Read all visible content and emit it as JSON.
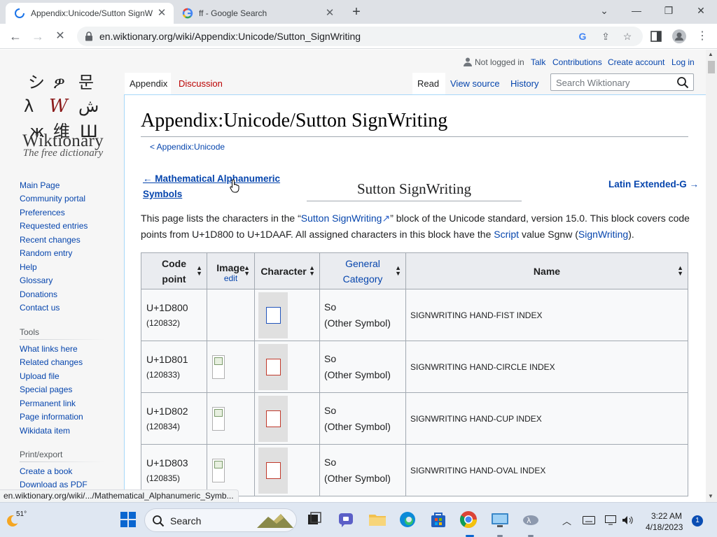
{
  "browser": {
    "tabs": [
      {
        "title": "Appendix:Unicode/Sutton SignW",
        "active": true
      },
      {
        "title": "ff - Google Search",
        "active": false
      }
    ],
    "url": "en.wiktionary.org/wiki/Appendix:Unicode/Sutton_SignWriting",
    "status_url": "en.wiktionary.org/wiki/.../Mathematical_Alphanumeric_Symb..."
  },
  "site": {
    "logo_glyphs": [
      "シ",
      "ዎ",
      "문",
      "λ",
      "W",
      "ش",
      "ж",
      "维",
      "Ш"
    ],
    "name": "Wiktionary",
    "tagline": "The free dictionary"
  },
  "sidebar": {
    "nav": [
      "Main Page",
      "Community portal",
      "Preferences",
      "Requested entries",
      "Recent changes",
      "Random entry",
      "Help",
      "Glossary",
      "Donations",
      "Contact us"
    ],
    "tools_heading": "Tools",
    "tools": [
      "What links here",
      "Related changes",
      "Upload file",
      "Special pages",
      "Permanent link",
      "Page information",
      "Wikidata item"
    ],
    "print_heading": "Print/export",
    "print": [
      "Create a book",
      "Download as PDF"
    ]
  },
  "personal": {
    "not_logged_in": "Not logged in",
    "talk": "Talk",
    "contributions": "Contributions",
    "create_account": "Create account",
    "log_in": "Log in"
  },
  "tabs": {
    "appendix": "Appendix",
    "discussion": "Discussion",
    "read": "Read",
    "view_source": "View source",
    "history": "History"
  },
  "search": {
    "placeholder": "Search Wiktionary"
  },
  "article": {
    "title": "Appendix:Unicode/Sutton SignWriting",
    "subpage": "< Appendix:Unicode",
    "prev_line1": "← Mathematical Alphanumeric",
    "prev_line2": "Symbols",
    "block_name": "Sutton SignWriting",
    "next": "Latin Extended-G →",
    "intro": {
      "p1": "This page lists the characters in the “",
      "link1": "Sutton SignWriting",
      "p2": "” block of the Unicode standard, version 15.0. This block covers code points from U+1D800 to U+1DAAF. All assigned characters in this block have the ",
      "link2": "Script",
      "p3": " value Sgnw (",
      "link3": "SignWriting",
      "p4": ")."
    }
  },
  "table": {
    "headers": {
      "code_point_1": "Code",
      "code_point_2": "point",
      "image": "Image",
      "image_edit": "edit",
      "character": "Character",
      "category_1": "General",
      "category_2": "Category",
      "name": "Name"
    },
    "rows": [
      {
        "code": "U+1D800",
        "decimal": "(120832)",
        "cat": "So",
        "cat_long": "(Other Symbol)",
        "name": "SIGNWRITING HAND-FIST INDEX"
      },
      {
        "code": "U+1D801",
        "decimal": "(120833)",
        "cat": "So",
        "cat_long": "(Other Symbol)",
        "name": "SIGNWRITING HAND-CIRCLE INDEX"
      },
      {
        "code": "U+1D802",
        "decimal": "(120834)",
        "cat": "So",
        "cat_long": "(Other Symbol)",
        "name": "SIGNWRITING HAND-CUP INDEX"
      },
      {
        "code": "U+1D803",
        "decimal": "(120835)",
        "cat": "So",
        "cat_long": "(Other Symbol)",
        "name": "SIGNWRITING HAND-OVAL INDEX"
      }
    ]
  },
  "taskbar": {
    "weather": "51°",
    "search_label": "Search",
    "time": "3:22 AM",
    "date": "4/18/2023",
    "notifications": "1"
  },
  "colors": {
    "link": "#0645ad",
    "red_link": "#ba0000",
    "accent": "#1a73e8"
  }
}
